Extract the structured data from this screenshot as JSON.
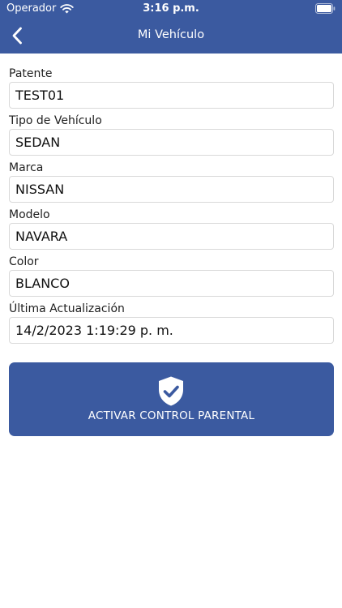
{
  "status_bar": {
    "carrier": "Operador",
    "time": "3:16 p.m.",
    "icons": [
      "wifi-icon",
      "battery-icon"
    ]
  },
  "nav": {
    "title": "Mi Vehículo",
    "back_icon": "chevron-left-icon"
  },
  "fields": [
    {
      "label": "Patente",
      "value": "TEST01"
    },
    {
      "label": "Tipo de Vehículo",
      "value": "SEDAN"
    },
    {
      "label": "Marca",
      "value": "NISSAN"
    },
    {
      "label": "Modelo",
      "value": "NAVARA"
    },
    {
      "label": "Color",
      "value": "BLANCO"
    },
    {
      "label": "Última Actualización",
      "value": "14/2/2023 1:19:29 p. m."
    }
  ],
  "parental_button": {
    "label": "ACTIVAR CONTROL PARENTAL",
    "icon": "shield-check-icon"
  },
  "colors": {
    "brand": "#3b5aa0",
    "background": "#ffffff",
    "field_border": "#d9d9d9"
  }
}
